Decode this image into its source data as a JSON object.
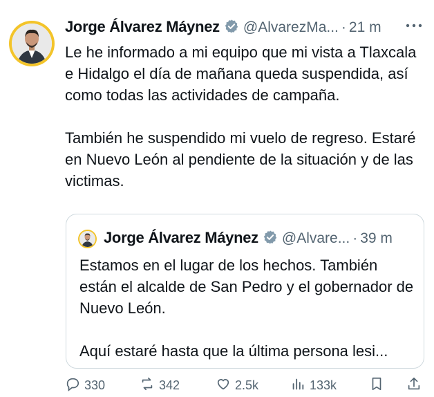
{
  "tweet": {
    "author_name": "Jorge Álvarez Máynez",
    "handle": "@AlvarezMa...",
    "separator": "·",
    "time": "21 m",
    "text_p1": "Le he informado a mi equipo que mi vista a Tlaxcala e Hidalgo el día de mañana queda suspendida, así como todas las actividades de campaña.",
    "text_p2": "También he suspendido mi vuelo de regreso. Estaré en Nuevo León al pendiente de la situación y de las victimas."
  },
  "quoted": {
    "author_name": "Jorge Álvarez Máynez",
    "handle": "@Alvare...",
    "separator": "·",
    "time": "39 m",
    "text_p1": "Estamos en el lugar de los hechos. También están el alcalde de San Pedro y el gobernador de Nuevo León.",
    "text_p2": "Aquí estaré hasta que la última persona lesi..."
  },
  "actions": {
    "replies": "330",
    "reposts": "342",
    "likes": "2.5k",
    "views": "133k"
  },
  "colors": {
    "verified": "#829aab",
    "muted": "#536471",
    "avatar_ring": "#f3c42a"
  },
  "icons": [
    "verified-badge-icon",
    "more-icon",
    "reply-icon",
    "repost-icon",
    "like-icon",
    "views-icon",
    "bookmark-icon",
    "share-icon"
  ]
}
